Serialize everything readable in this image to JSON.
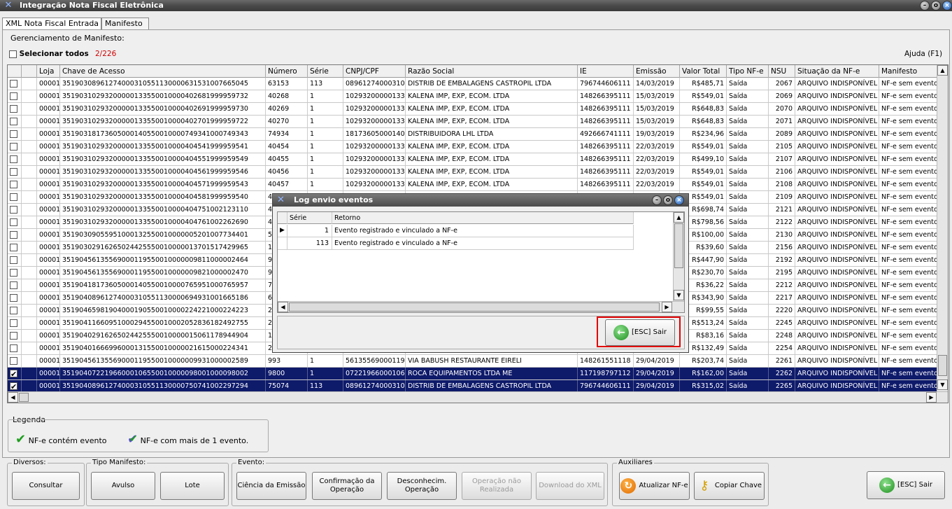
{
  "window": {
    "title": "Integração Nota Fiscal Eletrônica"
  },
  "tabs": [
    "XML Nota Fiscal Entrada",
    "Manifesto"
  ],
  "panel": {
    "group_title": "Gerenciamento de Manifesto:",
    "select_all_label": "Selecionar todos",
    "counter": "2/226",
    "help": "Ajuda (F1)"
  },
  "grid": {
    "columns": [
      "",
      "Loja",
      "Chave de Acesso",
      "Número",
      "Série",
      "CNPJ/CPF",
      "Razão Social",
      "IE",
      "Emissão",
      "Valor Total",
      "Tipo NF-e",
      "NSU",
      "Situação da NF-e",
      "Manifesto"
    ],
    "rows": [
      {
        "checked": false,
        "loja": "00001",
        "chave": "35190308961274000310551130000631531007665045",
        "numero": "63153",
        "serie": "113",
        "cnpj": "08961274000310",
        "razao": "DISTRIB DE EMBALAGENS CASTROPIL LTDA",
        "ie": "796744606111",
        "emissao": "14/03/2019",
        "valor": "R$485,71",
        "tipo": "Saída",
        "nsu": "2067",
        "situacao": "ARQUIVO INDISPONÍVEL",
        "manifesto": "NF-e sem evento"
      },
      {
        "checked": false,
        "loja": "00001",
        "chave": "35190310293200000133550010000402681999959732",
        "numero": "40268",
        "serie": "1",
        "cnpj": "10293200000133",
        "razao": "KALENA IMP, EXP, ECOM. LTDA",
        "ie": "148266395111",
        "emissao": "15/03/2019",
        "valor": "R$549,01",
        "tipo": "Saída",
        "nsu": "2069",
        "situacao": "ARQUIVO INDISPONÍVEL",
        "manifesto": "NF-e sem evento"
      },
      {
        "checked": false,
        "loja": "00001",
        "chave": "35190310293200000133550010000402691999959730",
        "numero": "40269",
        "serie": "1",
        "cnpj": "10293200000133",
        "razao": "KALENA IMP, EXP, ECOM. LTDA",
        "ie": "148266395111",
        "emissao": "15/03/2019",
        "valor": "R$648,83",
        "tipo": "Saída",
        "nsu": "2070",
        "situacao": "ARQUIVO INDISPONÍVEL",
        "manifesto": "NF-e sem evento"
      },
      {
        "checked": false,
        "loja": "00001",
        "chave": "35190310293200000133550010000402701999959722",
        "numero": "40270",
        "serie": "1",
        "cnpj": "10293200000133",
        "razao": "KALENA IMP, EXP, ECOM. LTDA",
        "ie": "148266395111",
        "emissao": "15/03/2019",
        "valor": "R$648,83",
        "tipo": "Saída",
        "nsu": "2071",
        "situacao": "ARQUIVO INDISPONÍVEL",
        "manifesto": "NF-e sem evento"
      },
      {
        "checked": false,
        "loja": "00001",
        "chave": "35190318173605000140550010000749341000749343",
        "numero": "74934",
        "serie": "1",
        "cnpj": "18173605000140",
        "razao": "DISTRIBUIDORA LHL LTDA",
        "ie": "492666741111",
        "emissao": "19/03/2019",
        "valor": "R$234,96",
        "tipo": "Saída",
        "nsu": "2089",
        "situacao": "ARQUIVO INDISPONÍVEL",
        "manifesto": "NF-e sem evento"
      },
      {
        "checked": false,
        "loja": "00001",
        "chave": "35190310293200000133550010000404541999959541",
        "numero": "40454",
        "serie": "1",
        "cnpj": "10293200000133",
        "razao": "KALENA IMP, EXP, ECOM. LTDA",
        "ie": "148266395111",
        "emissao": "22/03/2019",
        "valor": "R$549,01",
        "tipo": "Saída",
        "nsu": "2105",
        "situacao": "ARQUIVO INDISPONÍVEL",
        "manifesto": "NF-e sem evento"
      },
      {
        "checked": false,
        "loja": "00001",
        "chave": "35190310293200000133550010000404551999959549",
        "numero": "40455",
        "serie": "1",
        "cnpj": "10293200000133",
        "razao": "KALENA IMP, EXP, ECOM. LTDA",
        "ie": "148266395111",
        "emissao": "22/03/2019",
        "valor": "R$499,10",
        "tipo": "Saída",
        "nsu": "2107",
        "situacao": "ARQUIVO INDISPONÍVEL",
        "manifesto": "NF-e sem evento"
      },
      {
        "checked": false,
        "loja": "00001",
        "chave": "35190310293200000133550010000404561999959546",
        "numero": "40456",
        "serie": "1",
        "cnpj": "10293200000133",
        "razao": "KALENA IMP, EXP, ECOM. LTDA",
        "ie": "148266395111",
        "emissao": "22/03/2019",
        "valor": "R$549,01",
        "tipo": "Saída",
        "nsu": "2106",
        "situacao": "ARQUIVO INDISPONÍVEL",
        "manifesto": "NF-e sem evento"
      },
      {
        "checked": false,
        "loja": "00001",
        "chave": "35190310293200000133550010000404571999959543",
        "numero": "40457",
        "serie": "1",
        "cnpj": "10293200000133",
        "razao": "KALENA IMP, EXP, ECOM. LTDA",
        "ie": "148266395111",
        "emissao": "22/03/2019",
        "valor": "R$549,01",
        "tipo": "Saída",
        "nsu": "2108",
        "situacao": "ARQUIVO INDISPONÍVEL",
        "manifesto": "NF-e sem evento"
      },
      {
        "checked": false,
        "loja": "00001",
        "chave": "35190310293200000133550010000404581999959540",
        "numero": "4",
        "serie": "",
        "cnpj": "",
        "razao": "",
        "ie": "",
        "emissao": "",
        "valor": "R$549,01",
        "tipo": "Saída",
        "nsu": "2109",
        "situacao": "ARQUIVO INDISPONÍVEL",
        "manifesto": "NF-e sem evento"
      },
      {
        "checked": false,
        "loja": "00001",
        "chave": "35190310293200000133550010000404751002123110",
        "numero": "4",
        "serie": "",
        "cnpj": "",
        "razao": "",
        "ie": "",
        "emissao": "",
        "valor": "R$698,74",
        "tipo": "Saída",
        "nsu": "2121",
        "situacao": "ARQUIVO INDISPONÍVEL",
        "manifesto": "NF-e sem evento"
      },
      {
        "checked": false,
        "loja": "00001",
        "chave": "35190310293200000133550010000404761002262690",
        "numero": "4",
        "serie": "",
        "cnpj": "",
        "razao": "",
        "ie": "",
        "emissao": "",
        "valor": "R$798,56",
        "tipo": "Saída",
        "nsu": "2122",
        "situacao": "ARQUIVO INDISPONÍVEL",
        "manifesto": "NF-e sem evento"
      },
      {
        "checked": false,
        "loja": "00001",
        "chave": "35190309055951000132550010000005201007734401",
        "numero": "5",
        "serie": "",
        "cnpj": "",
        "razao": "",
        "ie": "",
        "emissao": "",
        "valor": "R$100,00",
        "tipo": "Saída",
        "nsu": "2130",
        "situacao": "ARQUIVO INDISPONÍVEL",
        "manifesto": "NF-e sem evento"
      },
      {
        "checked": false,
        "loja": "00001",
        "chave": "35190302916265024425550010000013701517429965",
        "numero": "1",
        "serie": "",
        "cnpj": "",
        "razao": "",
        "ie": "",
        "emissao": "",
        "valor": "R$39,60",
        "tipo": "Saída",
        "nsu": "2156",
        "situacao": "ARQUIVO INDISPONÍVEL",
        "manifesto": "NF-e sem evento"
      },
      {
        "checked": false,
        "loja": "00001",
        "chave": "35190456135569000119550010000009811000002464",
        "numero": "9",
        "serie": "",
        "cnpj": "",
        "razao": "",
        "ie": "",
        "emissao": "",
        "valor": "R$447,90",
        "tipo": "Saída",
        "nsu": "2192",
        "situacao": "ARQUIVO INDISPONÍVEL",
        "manifesto": "NF-e sem evento"
      },
      {
        "checked": false,
        "loja": "00001",
        "chave": "35190456135569000119550010000009821000002470",
        "numero": "9",
        "serie": "",
        "cnpj": "",
        "razao": "",
        "ie": "",
        "emissao": "",
        "valor": "R$230,70",
        "tipo": "Saída",
        "nsu": "2195",
        "situacao": "ARQUIVO INDISPONÍVEL",
        "manifesto": "NF-e sem evento"
      },
      {
        "checked": false,
        "loja": "00001",
        "chave": "35190418173605000140550010000765951000765957",
        "numero": "7",
        "serie": "",
        "cnpj": "",
        "razao": "",
        "ie": "",
        "emissao": "",
        "valor": "R$36,22",
        "tipo": "Saída",
        "nsu": "2212",
        "situacao": "ARQUIVO INDISPONÍVEL",
        "manifesto": "NF-e sem evento"
      },
      {
        "checked": false,
        "loja": "00001",
        "chave": "35190408961274000310551130000694931001665186",
        "numero": "6",
        "serie": "",
        "cnpj": "",
        "razao": "",
        "ie": "",
        "emissao": "",
        "valor": "R$343,90",
        "tipo": "Saída",
        "nsu": "2217",
        "situacao": "ARQUIVO INDISPONÍVEL",
        "manifesto": "NF-e sem evento"
      },
      {
        "checked": false,
        "loja": "00001",
        "chave": "35190465981904000190550010000224221000224223",
        "numero": "2",
        "serie": "",
        "cnpj": "",
        "razao": "",
        "ie": "",
        "emissao": "",
        "valor": "R$99,55",
        "tipo": "Saída",
        "nsu": "2220",
        "situacao": "ARQUIVO INDISPONÍVEL",
        "manifesto": "NF-e sem evento"
      },
      {
        "checked": false,
        "loja": "00001",
        "chave": "35190411660951000294550010002052836182492755",
        "numero": "2",
        "serie": "",
        "cnpj": "",
        "razao": "",
        "ie": "",
        "emissao": "",
        "valor": "R$513,24",
        "tipo": "Saída",
        "nsu": "2245",
        "situacao": "ARQUIVO INDISPONÍVEL",
        "manifesto": "NF-e sem evento"
      },
      {
        "checked": false,
        "loja": "00001",
        "chave": "35190402916265024425550010000015061178944904",
        "numero": "1",
        "serie": "",
        "cnpj": "",
        "razao": "",
        "ie": "",
        "emissao": "",
        "valor": "R$83,16",
        "tipo": "Saída",
        "nsu": "2248",
        "situacao": "ARQUIVO INDISPONÍVEL",
        "manifesto": "NF-e sem evento"
      },
      {
        "checked": false,
        "loja": "00001",
        "chave": "35190401666996000131550010000021615000224341",
        "numero": "2",
        "serie": "",
        "cnpj": "",
        "razao": "",
        "ie": "",
        "emissao": "",
        "valor": "R$132,49",
        "tipo": "Saída",
        "nsu": "2254",
        "situacao": "ARQUIVO INDISPONÍVEL",
        "manifesto": "NF-e sem evento"
      },
      {
        "checked": false,
        "loja": "00001",
        "chave": "35190456135569000119550010000009931000002589",
        "numero": "993",
        "serie": "1",
        "cnpj": "56135569000119",
        "razao": "VIA BABUSH RESTAURANTE EIRELI",
        "ie": "148261551118",
        "emissao": "29/04/2019",
        "valor": "R$203,74",
        "tipo": "Saída",
        "nsu": "2261",
        "situacao": "ARQUIVO INDISPONÍVEL",
        "manifesto": "NF-e sem evento"
      },
      {
        "checked": true,
        "selected": true,
        "loja": "00001",
        "chave": "35190407221966000106550010000098001000098002",
        "numero": "9800",
        "serie": "1",
        "cnpj": "07221966000106",
        "razao": "ROCA EQUIPAMENTOS LTDA ME",
        "ie": "117198797112",
        "emissao": "29/04/2019",
        "valor": "R$162,00",
        "tipo": "Saída",
        "nsu": "2262",
        "situacao": "ARQUIVO INDISPONÍVEL",
        "manifesto": "NF-e sem evento"
      },
      {
        "checked": true,
        "selected": true,
        "loja": "00001",
        "chave": "35190408961274000310551130000750741002297294",
        "numero": "75074",
        "serie": "113",
        "cnpj": "08961274000310",
        "razao": "DISTRIB DE EMBALAGENS CASTROPIL LTDA",
        "ie": "796744606111",
        "emissao": "29/04/2019",
        "valor": "R$315,02",
        "tipo": "Saída",
        "nsu": "2265",
        "situacao": "ARQUIVO INDISPONÍVEL",
        "manifesto": "NF-e sem evento"
      }
    ]
  },
  "legend": {
    "title": "Legenda",
    "item1": "NF-e contém evento",
    "item2": "NF-e com mais de 1 evento."
  },
  "groups": {
    "diversos": {
      "title": "Diversos:",
      "consultar": "Consultar"
    },
    "tipo": {
      "title": "Tipo Manifesto:",
      "avulso": "Avulso",
      "lote": "Lote"
    },
    "evento": {
      "title": "Evento:",
      "ciencia": "Ciência da Emissão",
      "confirmacao1": "Confirmação da",
      "confirmacao2": "Operação",
      "desconhec1": "Desconhecim.",
      "desconhec2": "Operação",
      "naorealizada1": "Operação não",
      "naorealizada2": "Realizada",
      "download": "Download do XML"
    },
    "auxiliares": {
      "title": "Auxiliares",
      "atualizar": "Atualizar NF-e",
      "copiar": "Copiar Chave"
    },
    "sair": "[ESC] Sair"
  },
  "dialog": {
    "title": "Log envio eventos",
    "columns": [
      "Série",
      "Retorno"
    ],
    "rows": [
      {
        "serie": "1",
        "retorno": "Evento registrado e vinculado a NF-e"
      },
      {
        "serie": "113",
        "retorno": "Evento registrado e vinculado a NF-e"
      }
    ],
    "sair": "[ESC] Sair"
  },
  "colors": {
    "selected_row": "#0e1a6a",
    "counter": "#d00000",
    "highlight_frame": "#e00000",
    "check_green": "#1e9e1e"
  }
}
